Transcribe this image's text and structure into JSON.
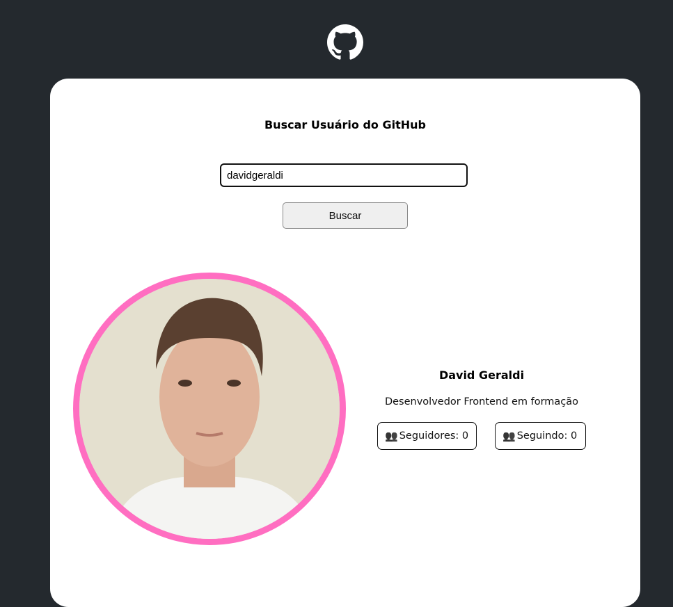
{
  "header": {
    "logo_icon": "github-icon"
  },
  "search": {
    "title": "Buscar Usuário do GitHub",
    "input_value": "davidgeraldi",
    "button_label": "Buscar"
  },
  "profile": {
    "name": "David Geraldi",
    "bio": "Desenvolvedor Frontend em formação",
    "followers_label": "Seguidores: 0",
    "following_label": "Seguindo: 0",
    "stat_icon": "👥",
    "avatar_border_color": "#ff6ec1"
  }
}
